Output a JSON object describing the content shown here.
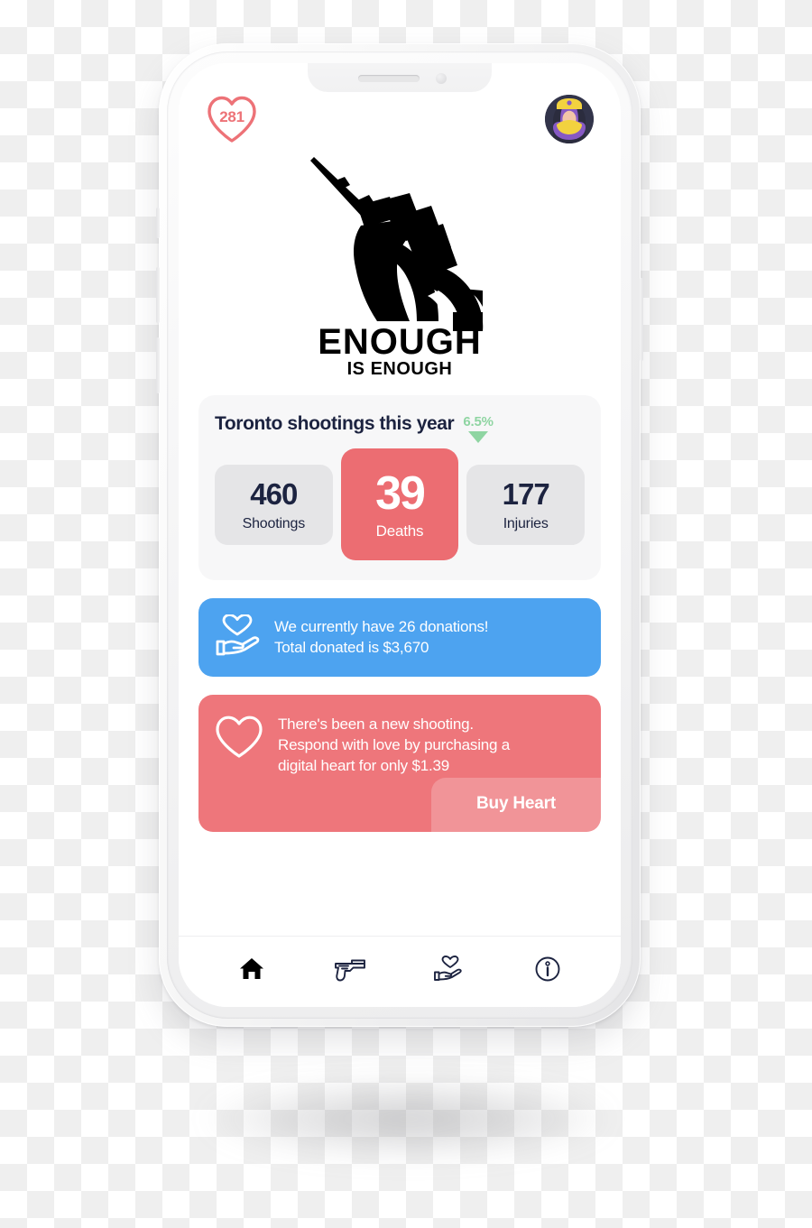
{
  "device": {
    "notch": {
      "speaker": "speaker-grille",
      "camera": "front-camera"
    },
    "buttons": [
      "silent-switch",
      "volume-up",
      "volume-down",
      "power"
    ]
  },
  "topbar": {
    "heart_badge": {
      "icon": "heart-icon",
      "count": "281"
    },
    "avatar": {
      "icon": "avatar",
      "alt": "user-avatar"
    }
  },
  "logo": {
    "icon": "fist-holding-broken-gun-icon",
    "title": "ENOUGH",
    "subtitle": "IS ENOUGH"
  },
  "stats": {
    "title": "Toronto shootings this year",
    "trend": {
      "value": "6.5%",
      "direction": "down",
      "color": "#8FD5A2"
    },
    "cells": [
      {
        "number": "460",
        "label": "Shootings",
        "highlight": false
      },
      {
        "number": "39",
        "label": "Deaths",
        "highlight": true
      },
      {
        "number": "177",
        "label": "Injuries",
        "highlight": false
      }
    ]
  },
  "donation_banner": {
    "icon": "hand-holding-heart-icon",
    "color": "#4DA3F0",
    "line1": "We currently have 26 donations!",
    "line2": "Total donated is $3,670"
  },
  "alert_banner": {
    "icon": "heart-outline-icon",
    "color": "#EE767B",
    "line1": "There's been a new shooting.",
    "line2": "Respond with love by purchasing a",
    "line3": "digital heart for only $1.39",
    "button_label": "Buy Heart"
  },
  "bottom_nav": {
    "items": [
      {
        "name": "home",
        "icon": "home-icon",
        "active": true
      },
      {
        "name": "shootings",
        "icon": "gun-icon",
        "active": false
      },
      {
        "name": "donate",
        "icon": "hand-holding-heart-icon",
        "active": false
      },
      {
        "name": "info",
        "icon": "info-circle-icon",
        "active": false
      }
    ]
  }
}
